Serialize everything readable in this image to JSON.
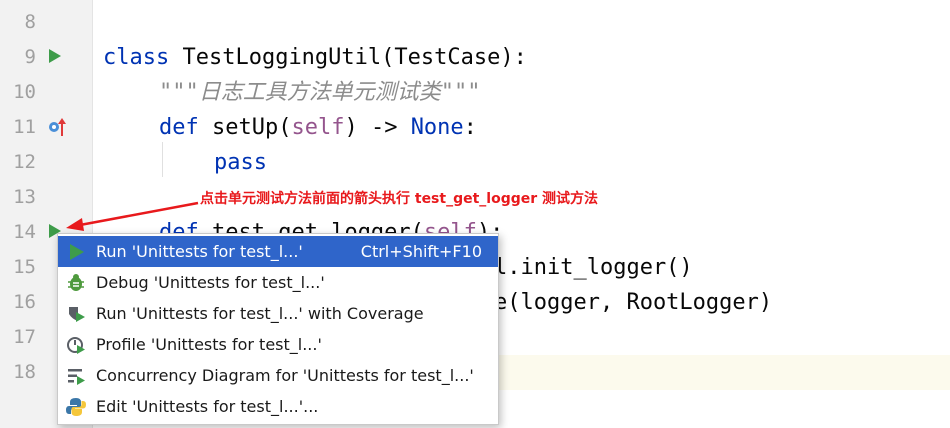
{
  "editor": {
    "line_numbers": [
      "8",
      "9",
      "10",
      "11",
      "12",
      "13",
      "14",
      "15",
      "16",
      "17",
      "18"
    ],
    "code": {
      "l9": {
        "kw": "class",
        "rest": " TestLoggingUtil(TestCase):"
      },
      "l10": {
        "doc": "\"\"\"日志工具方法单元测试类\"\"\""
      },
      "l11": {
        "kw": "def",
        "name": " setUp(",
        "self": "self",
        "rest": ") -> ",
        "kw2": "None",
        "end": ":"
      },
      "l12": {
        "kw": "pass"
      },
      "l14": {
        "kw": "def",
        "name": " test_get_logger(",
        "self": "self",
        "end": "):"
      },
      "l15": {
        "rest": "l.init_logger()"
      },
      "l16": {
        "rest": "e(logger, RootLogger)"
      }
    },
    "gutter_icons": {
      "l9": "run-triangle-icon",
      "l11": "override-method-icon",
      "l14": "run-triangle-icon"
    }
  },
  "annotation": "点击单元测试方法前面的箭头执行 test_get_logger 测试方法",
  "context_menu": {
    "items": [
      {
        "label": "Run 'Unittests for test_l...'",
        "shortcut": "Ctrl+Shift+F10",
        "icon": "run-icon",
        "selected": true
      },
      {
        "label": "Debug 'Unittests for test_l...'",
        "icon": "debug-bug-icon"
      },
      {
        "label": "Run 'Unittests for test_l...' with Coverage",
        "icon": "coverage-shield-icon"
      },
      {
        "label": "Profile 'Unittests for test_l...'",
        "icon": "profile-icon"
      },
      {
        "label": "Concurrency Diagram for 'Unittests for test_l...'",
        "icon": "concurrency-diagram-icon"
      },
      {
        "label": "Edit 'Unittests for test_l...'...",
        "icon": "python-edit-icon"
      }
    ]
  },
  "colors": {
    "accent": "#2f65ca",
    "annotation": "#e8191c",
    "run_green": "#3e9c4a"
  }
}
